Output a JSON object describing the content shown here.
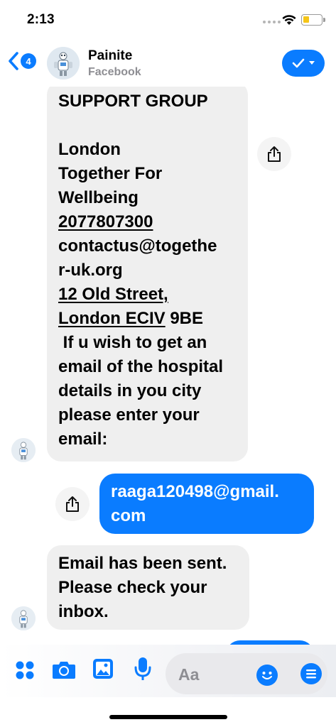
{
  "status_bar": {
    "time": "2:13"
  },
  "header": {
    "back_badge": "4",
    "contact_name": "Painite",
    "contact_subtitle": "Facebook"
  },
  "messages": [
    {
      "direction": "incoming",
      "lines": [
        "SUPPORT GROUP",
        "",
        "London",
        "Together For",
        "Wellbeing",
        "2077807300",
        "contactus@togethe",
        "r-uk.org",
        "12 Old Street,",
        "London ECIV",
        " 9BE",
        " If u wish to get an",
        "email of the hospital",
        "details in you city",
        "please enter your",
        "email:"
      ]
    },
    {
      "direction": "outgoing",
      "lines": [
        "raaga120498@gmail.",
        "com"
      ]
    },
    {
      "direction": "incoming",
      "lines": [
        "Email has been sent.",
        "Please check your",
        "inbox."
      ]
    }
  ],
  "composer": {
    "placeholder": "Aa"
  },
  "colors": {
    "accent": "#0a7cff",
    "incoming_bubble": "#efefef",
    "muted": "#8e8e93"
  },
  "icons": [
    "chevron-left-icon",
    "checkmark-icon",
    "share-icon",
    "apps-icon",
    "camera-icon",
    "photo-icon",
    "microphone-icon",
    "emoji-icon",
    "menu-icon"
  ]
}
